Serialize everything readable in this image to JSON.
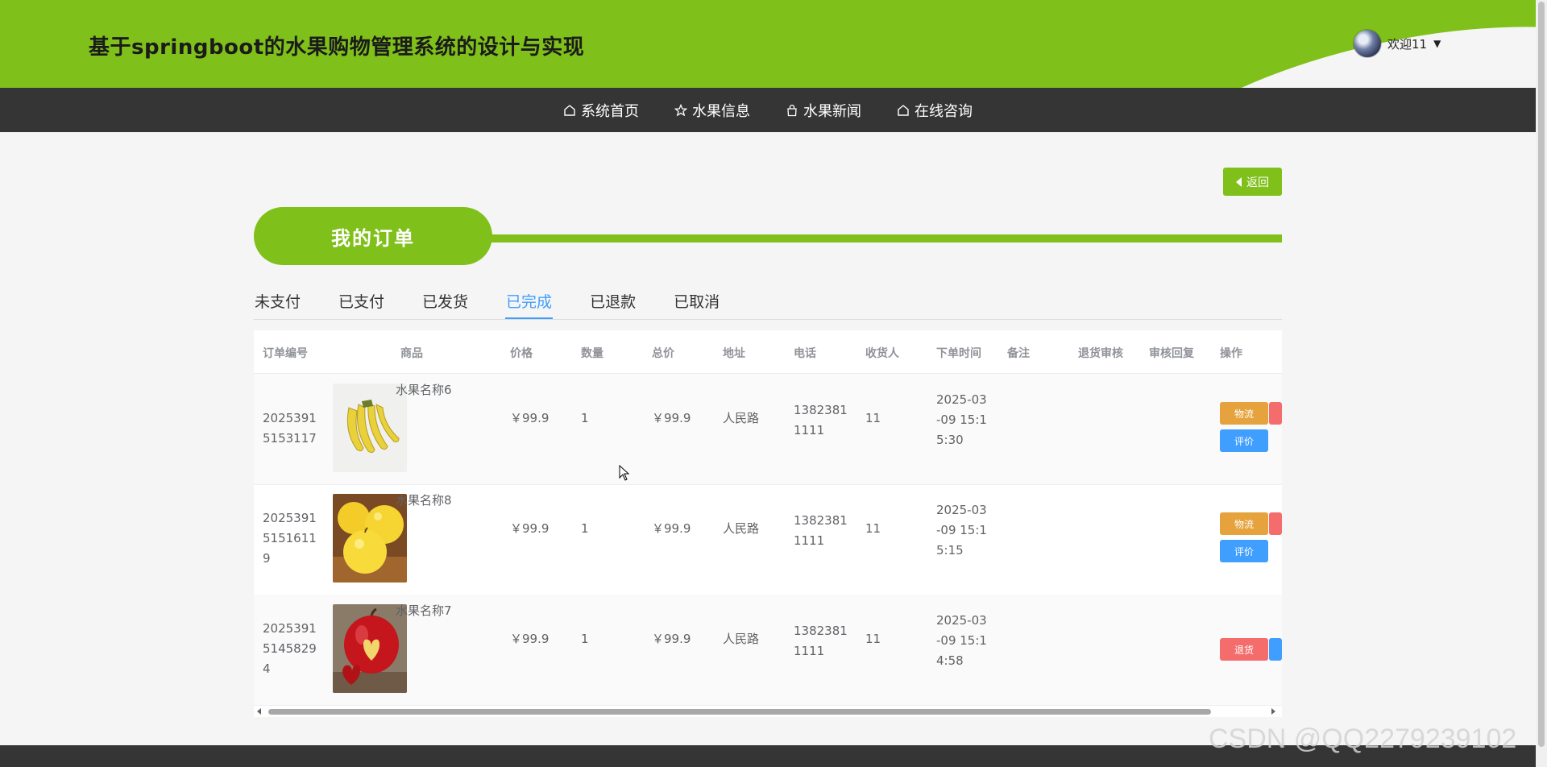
{
  "header": {
    "title": "基于springboot的水果购物管理系统的设计与实现",
    "welcome": "欢迎11",
    "accent_color": "#7fc01a"
  },
  "nav": {
    "items": [
      {
        "label": "系统首页",
        "icon": "home-icon"
      },
      {
        "label": "水果信息",
        "icon": "star-icon"
      },
      {
        "label": "水果新闻",
        "icon": "bag-icon"
      },
      {
        "label": "在线咨询",
        "icon": "home-icon"
      }
    ]
  },
  "back_button": {
    "label": "返回"
  },
  "section": {
    "title": "我的订单"
  },
  "tabs": {
    "items": [
      "未支付",
      "已支付",
      "已发货",
      "已完成",
      "已退款",
      "已取消"
    ],
    "active": "已完成"
  },
  "table": {
    "headers": [
      "订单编号",
      "商品",
      "价格",
      "数量",
      "总价",
      "地址",
      "电话",
      "收货人",
      "下单时间",
      "备注",
      "退货审核",
      "审核回复",
      "操作"
    ],
    "rows": [
      {
        "order_no": "20253915153117",
        "product": "水果名称6",
        "image": "banana",
        "price": "￥99.9",
        "qty": "1",
        "total": "￥99.9",
        "address": "人民路",
        "phone": "13823811111",
        "receiver": "11",
        "time": "2025-03-09 15:15:30",
        "ops": [
          "物流",
          "评价"
        ]
      },
      {
        "order_no": "202539151516119",
        "product": "水果名称8",
        "image": "yellow-apple",
        "price": "￥99.9",
        "qty": "1",
        "total": "￥99.9",
        "address": "人民路",
        "phone": "13823811111",
        "receiver": "11",
        "time": "2025-03-09 15:15:15",
        "ops": [
          "物流",
          "评价"
        ]
      },
      {
        "order_no": "202539151458294",
        "product": "水果名称7",
        "image": "red-apple",
        "price": "￥99.9",
        "qty": "1",
        "total": "￥99.9",
        "address": "人民路",
        "phone": "13823811111",
        "receiver": "11",
        "time": "2025-03-09 15:14:58",
        "ops": [
          "退货"
        ]
      }
    ]
  },
  "watermark": "CSDN @QQ2279239102"
}
